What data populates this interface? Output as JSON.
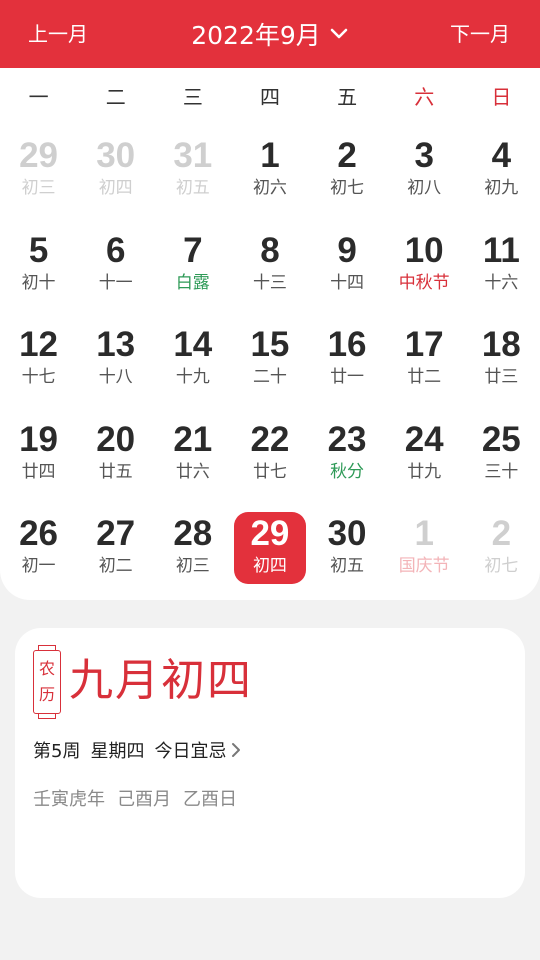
{
  "header": {
    "prev_label": "上一月",
    "title": "2022年9月",
    "next_label": "下一月",
    "accent_color": "#e3313c",
    "dropdown_icon": "chevron-down-icon"
  },
  "weekdays": [
    "一",
    "二",
    "三",
    "四",
    "五",
    "六",
    "日"
  ],
  "calendar": [
    {
      "day": "29",
      "lunar": "初三",
      "kind": "other"
    },
    {
      "day": "30",
      "lunar": "初四",
      "kind": "other"
    },
    {
      "day": "31",
      "lunar": "初五",
      "kind": "other"
    },
    {
      "day": "1",
      "lunar": "初六",
      "kind": "normal"
    },
    {
      "day": "2",
      "lunar": "初七",
      "kind": "normal"
    },
    {
      "day": "3",
      "lunar": "初八",
      "kind": "normal"
    },
    {
      "day": "4",
      "lunar": "初九",
      "kind": "normal"
    },
    {
      "day": "5",
      "lunar": "初十",
      "kind": "normal"
    },
    {
      "day": "6",
      "lunar": "十一",
      "kind": "normal"
    },
    {
      "day": "7",
      "lunar": "白露",
      "kind": "term"
    },
    {
      "day": "8",
      "lunar": "十三",
      "kind": "normal"
    },
    {
      "day": "9",
      "lunar": "十四",
      "kind": "normal"
    },
    {
      "day": "10",
      "lunar": "中秋节",
      "kind": "festival"
    },
    {
      "day": "11",
      "lunar": "十六",
      "kind": "normal"
    },
    {
      "day": "12",
      "lunar": "十七",
      "kind": "normal"
    },
    {
      "day": "13",
      "lunar": "十八",
      "kind": "normal"
    },
    {
      "day": "14",
      "lunar": "十九",
      "kind": "normal"
    },
    {
      "day": "15",
      "lunar": "二十",
      "kind": "normal"
    },
    {
      "day": "16",
      "lunar": "廿一",
      "kind": "normal"
    },
    {
      "day": "17",
      "lunar": "廿二",
      "kind": "normal"
    },
    {
      "day": "18",
      "lunar": "廿三",
      "kind": "normal"
    },
    {
      "day": "19",
      "lunar": "廿四",
      "kind": "normal"
    },
    {
      "day": "20",
      "lunar": "廿五",
      "kind": "normal"
    },
    {
      "day": "21",
      "lunar": "廿六",
      "kind": "normal"
    },
    {
      "day": "22",
      "lunar": "廿七",
      "kind": "normal"
    },
    {
      "day": "23",
      "lunar": "秋分",
      "kind": "term"
    },
    {
      "day": "24",
      "lunar": "廿九",
      "kind": "normal"
    },
    {
      "day": "25",
      "lunar": "三十",
      "kind": "normal"
    },
    {
      "day": "26",
      "lunar": "初一",
      "kind": "normal"
    },
    {
      "day": "27",
      "lunar": "初二",
      "kind": "normal"
    },
    {
      "day": "28",
      "lunar": "初三",
      "kind": "normal"
    },
    {
      "day": "29",
      "lunar": "初四",
      "kind": "today"
    },
    {
      "day": "30",
      "lunar": "初五",
      "kind": "normal"
    },
    {
      "day": "1",
      "lunar": "国庆节",
      "kind": "other-festival"
    },
    {
      "day": "2",
      "lunar": "初七",
      "kind": "other"
    }
  ],
  "info": {
    "badge_top": "农",
    "badge_bottom": "历",
    "lunar_date": "九月初四",
    "week": "第5周",
    "weekday": "星期四",
    "yiji_label": "今日宜忌",
    "year_ganzhi": "壬寅虎年",
    "month_ganzhi": "己酉月",
    "day_ganzhi": "乙酉日"
  }
}
